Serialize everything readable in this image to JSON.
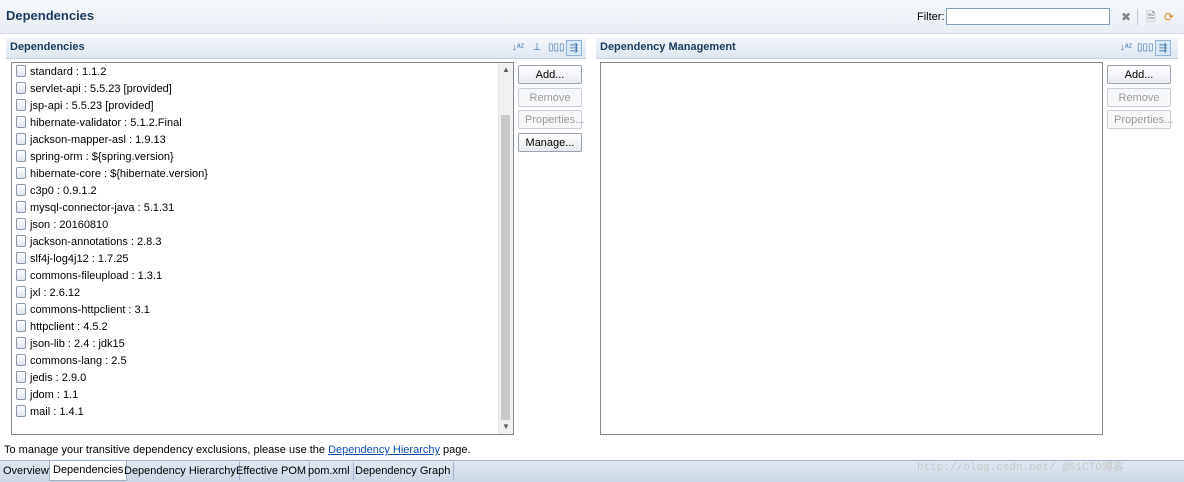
{
  "header": {
    "title": "Dependencies",
    "filter_label": "Filter:",
    "filter_value": "",
    "icons": [
      "clear-filter-icon",
      "open-pom-icon",
      "refresh-icon"
    ]
  },
  "dependencies": {
    "title": "Dependencies",
    "toolbar_icons": [
      "sort-alphabetically-icon",
      "show-groups-icon",
      "show-version-icon",
      "collapse-filter-icon"
    ],
    "items": [
      "standard : 1.1.2",
      "servlet-api : 5.5.23 [provided]",
      "jsp-api : 5.5.23 [provided]",
      "hibernate-validator : 5.1.2.Final",
      "jackson-mapper-asl : 1.9.13",
      "spring-orm : ${spring.version}",
      "hibernate-core : ${hibernate.version}",
      "c3p0 : 0.9.1.2",
      "mysql-connector-java : 5.1.31",
      "json : 20160810",
      "jackson-annotations : 2.8.3",
      "slf4j-log4j12 : 1.7.25",
      "commons-fileupload : 1.3.1",
      "jxl : 2.6.12",
      "commons-httpclient : 3.1",
      "httpclient : 4.5.2",
      "json-lib : 2.4 : jdk15",
      "commons-lang : 2.5",
      "jedis : 2.9.0",
      "jdom : 1.1",
      "mail : 1.4.1"
    ],
    "buttons": {
      "add": "Add...",
      "remove": "Remove",
      "properties": "Properties...",
      "manage": "Manage..."
    }
  },
  "management": {
    "title": "Dependency Management",
    "toolbar_icons": [
      "sort-alphabetically-icon",
      "show-version-icon",
      "collapse-filter-icon"
    ],
    "items": [],
    "buttons": {
      "add": "Add...",
      "remove": "Remove",
      "properties": "Properties..."
    }
  },
  "info": {
    "prefix": "To manage your transitive dependency exclusions, please use the ",
    "link": "Dependency Hierarchy",
    "suffix": " page."
  },
  "tabs": [
    {
      "label": "Overview",
      "active": false
    },
    {
      "label": "Dependencies",
      "active": true
    },
    {
      "label": "Dependency Hierarchy",
      "active": false
    },
    {
      "label": "Effective POM",
      "active": false
    },
    {
      "label": "pom.xml",
      "active": false
    },
    {
      "label": "Dependency Graph",
      "active": false
    }
  ],
  "watermark": "http://blog.csdn.net/ @51CTO博客"
}
